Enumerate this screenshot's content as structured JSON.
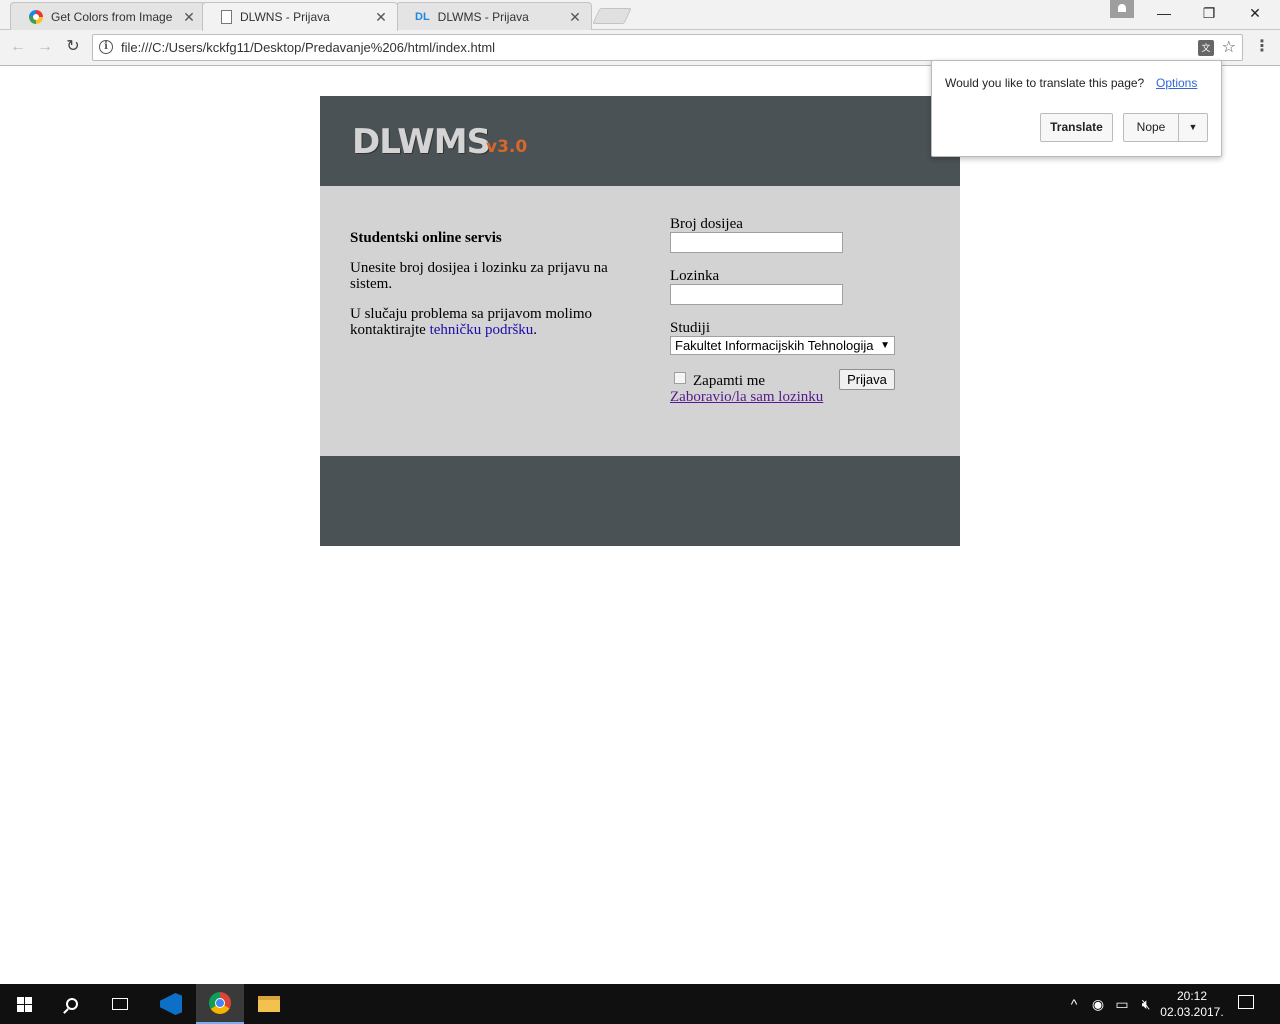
{
  "browser": {
    "tabs": [
      {
        "title": "Get Colors from Image",
        "icon": "color-wheel-icon"
      },
      {
        "title": "DLWNS - Prijava",
        "icon": "document-icon",
        "active": true
      },
      {
        "title": "DLWMS - Prijava",
        "icon": "dl-favicon-icon"
      }
    ],
    "close_glyph": "✕",
    "url": "file:///C:/Users/kckfg11/Desktop/Predavanje%206/html/index.html",
    "info_glyph": "i",
    "translate_icon_glyph": "文",
    "window_controls": {
      "minimize": "—",
      "restore": "❐",
      "close": "✕"
    }
  },
  "translate_bubble": {
    "question": "Would you like to translate this page?",
    "options_link": "Options",
    "translate_button": "Translate",
    "nope_button": "Nope",
    "dropdown_glyph": "▼"
  },
  "page": {
    "logo": "DLWMS",
    "version": "v3.0",
    "info": {
      "title": "Studentski online servis",
      "paragraph1": "Unesite broj dosijea i lozinku za prijavu na sistem.",
      "paragraph2_prefix": "U slučaju problema sa prijavom molimo kontaktirajte ",
      "support_link": "tehničku podršku",
      "paragraph2_suffix": "."
    },
    "form": {
      "dosije_label": "Broj dosijea",
      "dosije_value": "",
      "lozinka_label": "Lozinka",
      "lozinka_value": "",
      "studiji_label": "Studiji",
      "studiji_selected": "Fakultet Informacijskih Tehnologija",
      "remember_label": "Zapamti me",
      "remember_checked": false,
      "login_button": "Prijava",
      "forgot_link": "Zaboravio/la sam lozinku"
    },
    "colors": {
      "header_bg": "#4a5255",
      "content_bg": "#d3d3d3",
      "version_color": "#d9662b",
      "link_color": "#1a0dab"
    }
  },
  "taskbar": {
    "clock_time": "20:12",
    "clock_date": "02.03.2017."
  }
}
